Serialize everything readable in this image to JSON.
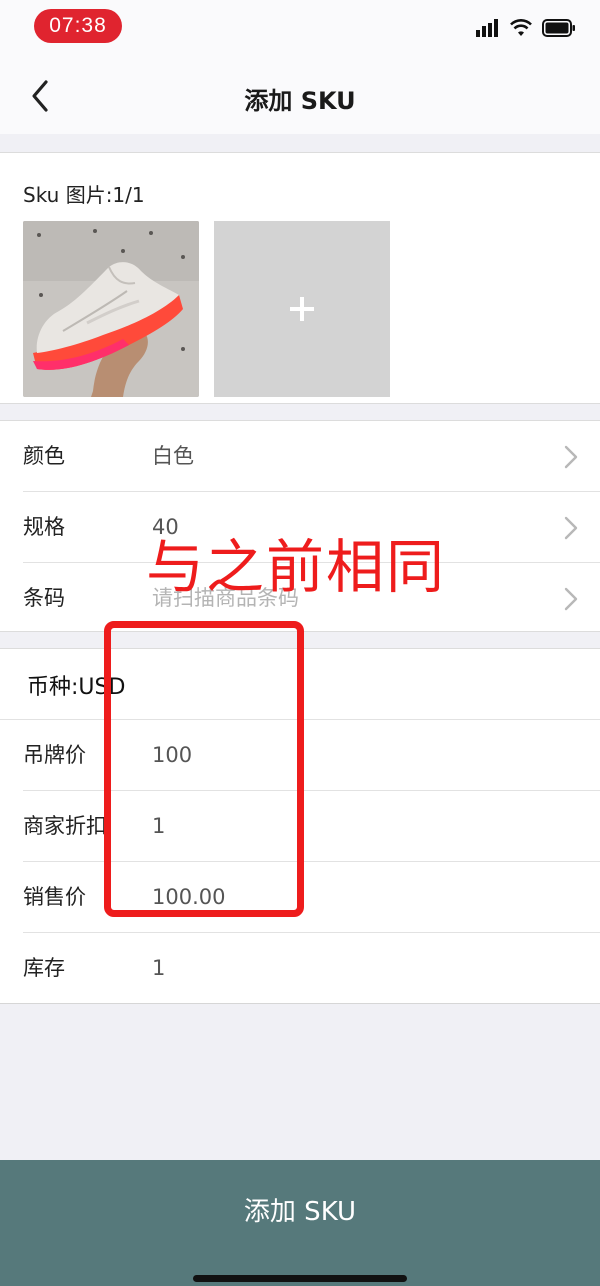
{
  "status_bar": {
    "time": "07:38"
  },
  "nav": {
    "title": "添加 SKU"
  },
  "images": {
    "label": "Sku 图片:1/1"
  },
  "attributes": [
    {
      "label": "颜色",
      "value": "白色",
      "placeholder": false
    },
    {
      "label": "规格",
      "value": "40",
      "placeholder": false
    },
    {
      "label": "条码",
      "value": "请扫描商品条码",
      "placeholder": true
    }
  ],
  "pricing": {
    "currency": "币种:USD",
    "rows": [
      {
        "label": "吊牌价",
        "value": "100"
      },
      {
        "label": "商家折扣",
        "value": "1"
      },
      {
        "label": "销售价",
        "value": "100.00"
      },
      {
        "label": "库存",
        "value": "1"
      }
    ]
  },
  "annotation": {
    "text": "与之前相同",
    "color": "#ee1c1c"
  },
  "submit": {
    "label": "添加 SKU"
  },
  "colors": {
    "accent_button": "#56797b",
    "status_time_pill": "#e0242f"
  }
}
